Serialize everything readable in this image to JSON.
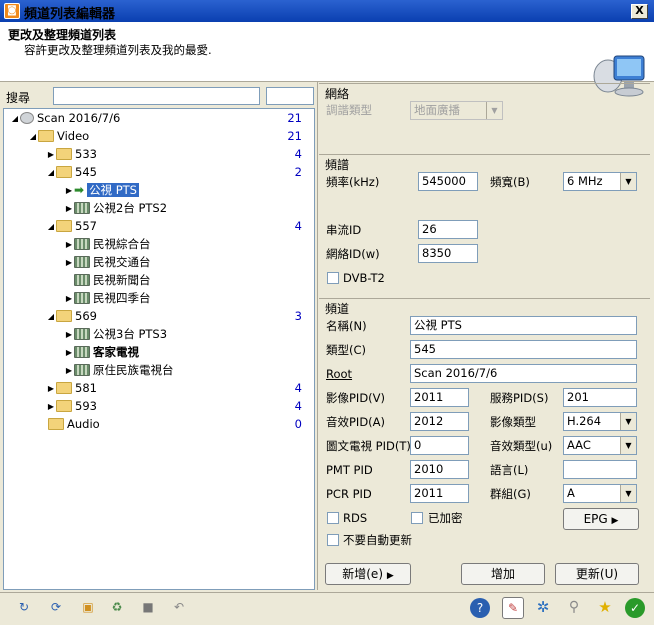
{
  "window": {
    "title": "頻道列表編輯器",
    "close": "X"
  },
  "header": {
    "title": "更改及整理頻道列表",
    "subtitle": "容許更改及整理頻道列表及我的最愛."
  },
  "search": {
    "label": "搜尋"
  },
  "tree": {
    "root": {
      "label": "Scan 2016/7/6",
      "count": "21"
    },
    "video": {
      "label": "Video",
      "count": "21"
    },
    "f533": {
      "label": "533",
      "count": "4"
    },
    "f545": {
      "label": "545",
      "count": "2"
    },
    "c545_1": "公視 PTS",
    "c545_2": "公視2台 PTS2",
    "f557": {
      "label": "557",
      "count": "4"
    },
    "c557_1": "民視綜合台",
    "c557_2": "民視交通台",
    "c557_3": "民視新聞台",
    "c557_4": "民視四季台",
    "f569": {
      "label": "569",
      "count": "3"
    },
    "c569_1": "公視3台 PTS3",
    "c569_2": "客家電視",
    "c569_3": "原住民族電視台",
    "f581": {
      "label": "581",
      "count": "4"
    },
    "f593": {
      "label": "593",
      "count": "4"
    },
    "audio": {
      "label": "Audio",
      "count": "0"
    }
  },
  "network": {
    "title": "網絡",
    "tune_type_label": "調諧類型",
    "tune_type_value": "地面廣播"
  },
  "freq": {
    "title": "頻譜",
    "freq_label": "頻率(kHz)",
    "freq_value": "545000",
    "bw_label": "頻寬(B)",
    "bw_value": "6 MHz",
    "stream_label": "串流ID",
    "stream_value": "26",
    "netid_label": "網絡ID(w)",
    "netid_value": "8350",
    "dvbt2_label": "DVB-T2"
  },
  "channel": {
    "title": "頻道",
    "name_label": "名稱(N)",
    "name_value": "公視 PTS",
    "type_label": "類型(C)",
    "type_value": "545",
    "root_label": "Root",
    "root_value": "Scan 2016/7/6",
    "vpid_label": "影像PID(V)",
    "vpid_value": "2011",
    "spid_label": "服務PID(S)",
    "spid_value": "201",
    "apid_label": "音效PID(A)",
    "apid_value": "2012",
    "vtype_label": "影像類型",
    "vtype_value": "H.264",
    "ttx_label": "圖文電視 PID(T)",
    "ttx_value": "0",
    "atype_label": "音效類型(u)",
    "atype_value": "AAC",
    "pmt_label": "PMT PID",
    "pmt_value": "2010",
    "lang_label": "語言(L)",
    "lang_value": "",
    "pcr_label": "PCR PID",
    "pcr_value": "2011",
    "group_label": "群組(G)",
    "group_value": "A",
    "rds_label": "RDS",
    "enc_label": "已加密",
    "epg_label": "EPG",
    "noupdate_label": "不要自動更新"
  },
  "buttons": {
    "new": "新增(e)",
    "add": "增加",
    "update": "更新(U)"
  }
}
